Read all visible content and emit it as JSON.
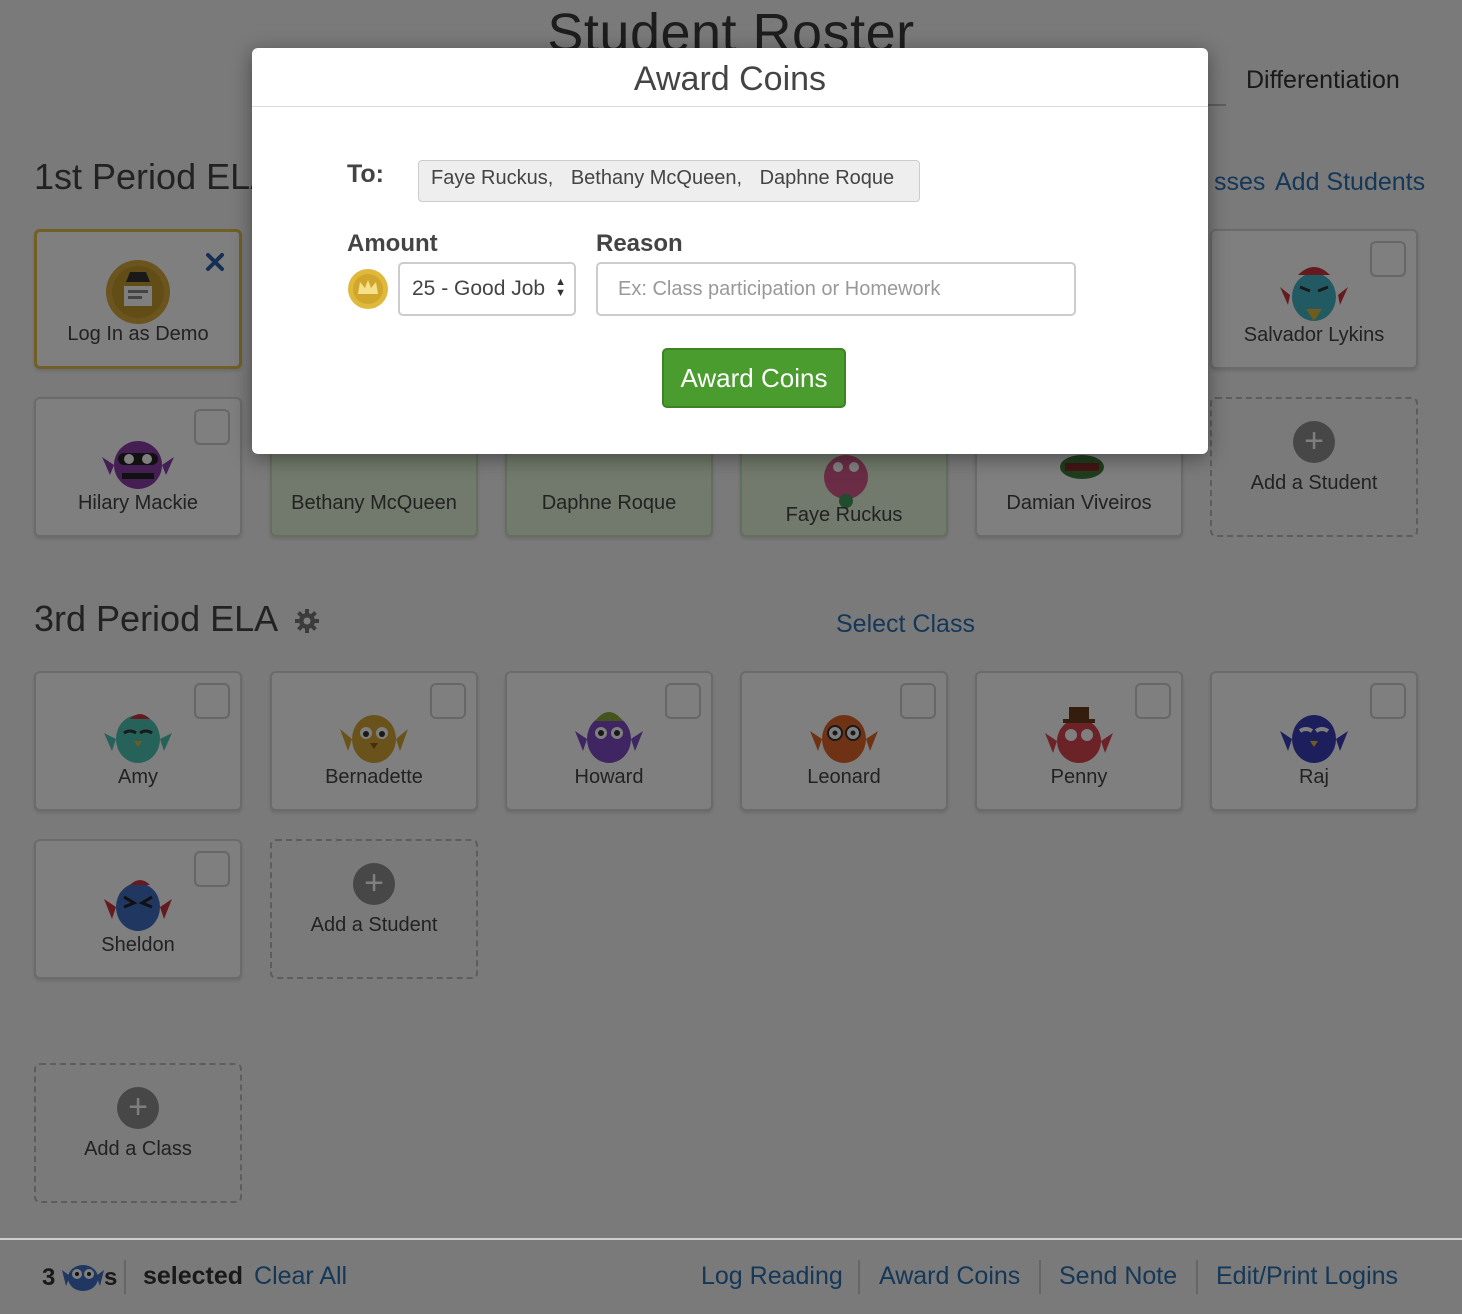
{
  "page": {
    "title": "Student Roster",
    "tab_differentiation": "Differentiation"
  },
  "class1": {
    "title": "1st Period ELA",
    "link_partial": "sses",
    "add_students": "Add Students",
    "demo_label": "Log In as Demo",
    "students": [
      "Salvador Lykins",
      "Hilary Mackie",
      "Bethany McQueen",
      "Daphne Roque",
      "Faye Ruckus",
      "Damian Viveiros"
    ],
    "add_student": "Add a Student"
  },
  "class3": {
    "title": "3rd Period ELA",
    "select_class": "Select Class",
    "students": [
      "Amy",
      "Bernadette",
      "Howard",
      "Leonard",
      "Penny",
      "Raj",
      "Sheldon"
    ],
    "add_student": "Add a Student"
  },
  "add_class": "Add a Class",
  "bottom": {
    "count": "3",
    "s": "s",
    "selected": "selected",
    "clear_all": "Clear All",
    "actions": [
      "Log Reading",
      "Award Coins",
      "Send Note",
      "Edit/Print Logins"
    ]
  },
  "modal": {
    "title": "Award Coins",
    "to_label": "To:",
    "recipients": [
      "Faye Ruckus,",
      "Bethany McQueen,",
      "Daphne Roque"
    ],
    "amount_label": "Amount",
    "amount_value": "25 - Good Job",
    "reason_label": "Reason",
    "reason_placeholder": "Ex: Class participation or Homework",
    "button": "Award Coins"
  },
  "colors": {
    "accent_link": "#2a6fb0",
    "button_green": "#4a9c2f",
    "selected_card": "#e3f5d8",
    "coin_gold": "#e0b83a"
  },
  "owl_colors": {
    "salvador": "#45b5c6",
    "hilary": "#8b3fa8",
    "bethany": "#2e9a7e",
    "daphne": "#6a3fb5",
    "faye": "#d45a8a",
    "damian": "#3e7d3a",
    "amy": "#4cc3b4",
    "bernadette": "#d3a637",
    "howard": "#7f4bc4",
    "leonard": "#e0652b",
    "penny": "#d8474f",
    "raj": "#3b3fb8",
    "sheldon": "#3e6fc2"
  }
}
